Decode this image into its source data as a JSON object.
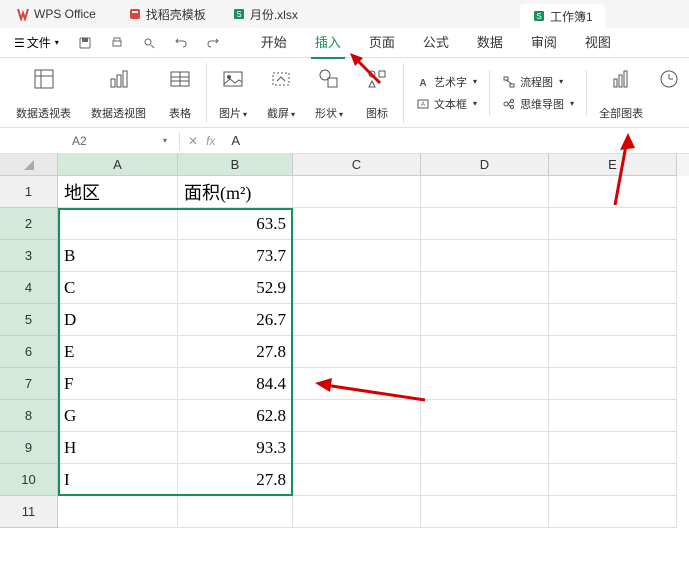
{
  "app": {
    "name": "WPS Office"
  },
  "tabs": [
    {
      "label": "找稻壳模板",
      "icon_color": "#d64541"
    },
    {
      "label": "月份.xlsx",
      "icon_color": "#1a8f5c"
    },
    {
      "label": "工作簿1",
      "icon_color": "#1a8f5c"
    }
  ],
  "file_menu": "文件",
  "menu_items": [
    "开始",
    "插入",
    "页面",
    "公式",
    "数据",
    "审阅",
    "视图"
  ],
  "active_menu_index": 1,
  "ribbon": {
    "pivot_table": "数据透视表",
    "pivot_chart": "数据透视图",
    "table": "表格",
    "picture": "图片",
    "screenshot": "截屏",
    "shape": "形状",
    "icon": "图标",
    "wordart": "艺术字",
    "textbox": "文本框",
    "flowchart": "流程图",
    "mindmap": "思维导图",
    "all_charts": "全部图表"
  },
  "cell_ref": "A2",
  "formula_value": "A",
  "columns": [
    "A",
    "B",
    "C",
    "D",
    "E"
  ],
  "row_numbers": [
    "1",
    "2",
    "3",
    "4",
    "5",
    "6",
    "7",
    "8",
    "9",
    "10",
    "11"
  ],
  "headers": {
    "region": "地区",
    "area": "面积(m²)"
  },
  "data": [
    {
      "region": "A",
      "area": "63.5"
    },
    {
      "region": "B",
      "area": "73.7"
    },
    {
      "region": "C",
      "area": "52.9"
    },
    {
      "region": "D",
      "area": "26.7"
    },
    {
      "region": "E",
      "area": "27.8"
    },
    {
      "region": "F",
      "area": "84.4"
    },
    {
      "region": "G",
      "area": "62.8"
    },
    {
      "region": "H",
      "area": "93.3"
    },
    {
      "region": "I",
      "area": "27.8"
    }
  ]
}
